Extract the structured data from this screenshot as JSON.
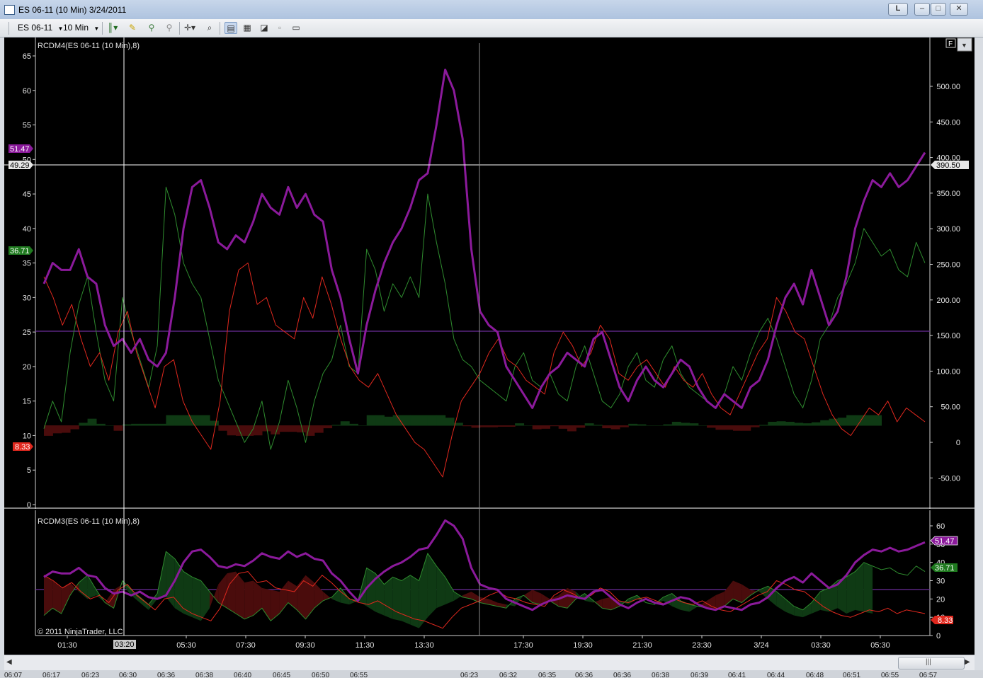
{
  "window": {
    "title": "ES 06-11 (10 Min)  3/24/2011",
    "small_button": "L"
  },
  "toolbar": {
    "instrument": "ES 06-11",
    "interval": "10 Min"
  },
  "icons": [
    "chart-icon",
    "bar-style-icon",
    "pencil-icon",
    "zoom-in-icon",
    "zoom-out-icon",
    "crosshair-icon",
    "magnifier-icon",
    "data-box-icon",
    "indicators-icon",
    "strategies-icon",
    "properties-icon",
    "drop-down-icon",
    "chevron-down-icon",
    "scroll-left-icon",
    "scroll-right-icon",
    "scroll-grip-icon"
  ],
  "colors": {
    "magenta": "#8b1a9b",
    "green": "#2e8b2e",
    "red": "#e0281e",
    "fill_green": "#0f3a14",
    "fill_red": "#4a0c0c",
    "zero_line": "#6b2c9a"
  },
  "upper_panel": {
    "label": "RCDM4(ES 06-11 (10 Min),8)",
    "left_ticks": [
      "65",
      "60",
      "55",
      "50",
      "45",
      "40",
      "35",
      "30",
      "25",
      "20",
      "15",
      "10",
      "5",
      "0"
    ],
    "right_ticks": [
      "500.00",
      "450.00",
      "400.00",
      "350.00",
      "300.00",
      "250.00",
      "200.00",
      "150.00",
      "100.00",
      "50.00",
      "0",
      "-50.00"
    ],
    "badge_magenta": "51.47",
    "badge_cursor": "49.29",
    "badge_green": "36.71",
    "badge_red": "8.33",
    "badge_right": "390.50",
    "panel_button": "F"
  },
  "lower_panel": {
    "label": "RCDM3(ES 06-11 (10 Min),8)",
    "right_ticks": [
      "60",
      "50",
      "40",
      "30",
      "20",
      "10",
      "0"
    ],
    "badge_magenta": "51.47",
    "badge_green": "36.71",
    "badge_red": "8.33",
    "copyright": "© 2011 NinjaTrader, LLC"
  },
  "x_axis": {
    "labels": [
      "01:30",
      "05:30",
      "07:30",
      "09:30",
      "11:30",
      "13:30",
      "17:30",
      "19:30",
      "21:30",
      "23:30",
      "3/24",
      "03:30",
      "05:30"
    ],
    "cursor_label": "03:20"
  },
  "bottom_strip": {
    "labels": [
      "06:07",
      "06:17",
      "06:23",
      "06:30",
      "06:36",
      "06:38",
      "06:40",
      "06:45",
      "06:50",
      "06:55",
      "06:23",
      "06:32",
      "06:35",
      "06:36",
      "06:36",
      "06:38",
      "06:39",
      "06:41",
      "06:44",
      "06:48",
      "06:51",
      "06:55",
      "06:57"
    ]
  },
  "chart_data": {
    "type": "line",
    "series": [
      {
        "color": "#8b1a9b",
        "panel": "upper",
        "values": [
          32,
          35,
          34,
          34,
          37,
          33,
          32,
          26,
          23,
          24,
          22,
          24,
          21,
          20,
          22,
          30,
          40,
          46,
          47,
          43,
          38,
          37,
          39,
          38,
          41,
          45,
          43,
          42,
          46,
          43,
          45,
          42,
          41,
          34,
          30,
          24,
          19,
          26,
          31,
          35,
          38,
          40,
          43,
          47,
          48,
          55,
          63,
          60,
          53,
          37,
          28,
          26,
          25,
          20,
          18,
          16,
          14,
          17,
          19,
          20,
          22,
          21,
          20,
          24,
          25,
          21,
          17,
          15,
          18,
          20,
          18,
          17,
          19,
          21,
          20,
          17,
          15,
          14,
          16,
          15,
          14,
          17,
          18,
          21,
          26,
          30,
          32,
          29,
          34,
          30,
          26,
          28,
          33,
          40,
          44,
          47,
          46,
          48,
          46,
          47,
          49,
          51
        ]
      },
      {
        "color": "#2e8b2e",
        "panel": "upper",
        "values": [
          11,
          15,
          12,
          22,
          29,
          33,
          25,
          18,
          15,
          30,
          25,
          21,
          17,
          23,
          46,
          42,
          35,
          32,
          30,
          24,
          18,
          15,
          12,
          9,
          11,
          15,
          8,
          12,
          18,
          14,
          9,
          15,
          19,
          21,
          26,
          20,
          19,
          37,
          34,
          28,
          32,
          30,
          33,
          30,
          45,
          38,
          32,
          24,
          21,
          20,
          18,
          17,
          16,
          15,
          20,
          22,
          18,
          17,
          19,
          16,
          15,
          20,
          23,
          19,
          15,
          14,
          16,
          20,
          22,
          18,
          17,
          21,
          23,
          19,
          17,
          16,
          15,
          14,
          16,
          20,
          18,
          22,
          25,
          27,
          24,
          20,
          16,
          14,
          18,
          24,
          26,
          30,
          32,
          35,
          40,
          38,
          36,
          37,
          34,
          33,
          38,
          35
        ]
      },
      {
        "color": "#e0281e",
        "panel": "upper",
        "values": [
          33,
          30,
          26,
          29,
          24,
          20,
          22,
          18,
          25,
          28,
          22,
          18,
          14,
          20,
          21,
          15,
          12,
          10,
          8,
          15,
          28,
          34,
          35,
          29,
          30,
          26,
          25,
          24,
          30,
          27,
          33,
          29,
          24,
          20,
          18,
          17,
          19,
          16,
          13,
          11,
          9,
          8,
          6,
          4,
          10,
          15,
          17,
          19,
          22,
          24,
          21,
          20,
          18,
          17,
          16,
          22,
          25,
          23,
          20,
          22,
          26,
          24,
          19,
          18,
          20,
          21,
          19,
          17,
          20,
          18,
          17,
          19,
          16,
          14,
          13,
          16,
          19,
          22,
          24,
          30,
          28,
          25,
          24,
          20,
          16,
          13,
          11,
          10,
          12,
          14,
          13,
          15,
          12,
          14,
          13,
          12
        ]
      }
    ]
  }
}
